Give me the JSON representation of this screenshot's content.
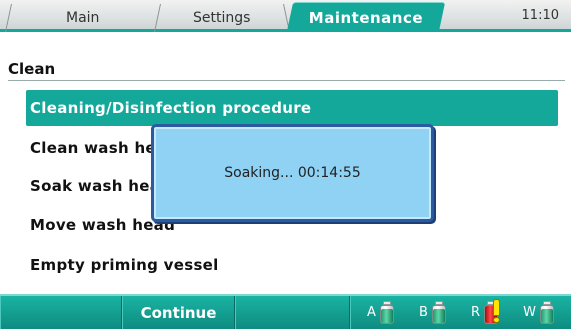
{
  "tabs": [
    {
      "label": "Main",
      "active": false
    },
    {
      "label": "Settings",
      "active": false
    },
    {
      "label": "Maintenance",
      "active": true
    }
  ],
  "clock": "11:10",
  "section": {
    "title": "Clean"
  },
  "menu": {
    "items": [
      {
        "label": "Cleaning/Disinfection procedure",
        "selected": true
      },
      {
        "label": "Clean wash head",
        "selected": false
      },
      {
        "label": "Soak wash head",
        "selected": false
      },
      {
        "label": "Move wash head",
        "selected": false
      },
      {
        "label": "Empty priming vessel",
        "selected": false
      }
    ]
  },
  "dialog": {
    "message": "Soaking... 00:14:55"
  },
  "softkeys": [
    "",
    "Continue",
    ""
  ],
  "bottles": [
    {
      "label": "A",
      "icon": "bottle-icon",
      "state": "ok"
    },
    {
      "label": "B",
      "icon": "bottle-icon",
      "state": "ok"
    },
    {
      "label": "R",
      "icon": "bottle-icon",
      "state": "warning"
    },
    {
      "label": "W",
      "icon": "bottle-icon",
      "state": "ok"
    }
  ],
  "colors": {
    "accent": "#13a89a",
    "dialog_bg": "#8fd2f4",
    "dialog_border": "#2b5aa0",
    "warning": "#ffe600",
    "bottle_ok": "#3fbf8a",
    "bottle_alert": "#d61a1a"
  }
}
